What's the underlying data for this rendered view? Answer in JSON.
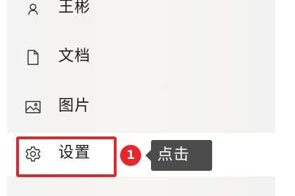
{
  "menu": {
    "items": [
      {
        "label": "王彬",
        "icon": "user-icon"
      },
      {
        "label": "文档",
        "icon": "document-icon"
      },
      {
        "label": "图片",
        "icon": "pictures-icon"
      },
      {
        "label": "设置",
        "icon": "gear-icon"
      }
    ]
  },
  "annotation": {
    "step_number": "1",
    "tooltip_text": "点击",
    "highlight_color": "#e0282b",
    "badge_color": "#e8262a",
    "tooltip_bg": "#4c4c4c"
  }
}
